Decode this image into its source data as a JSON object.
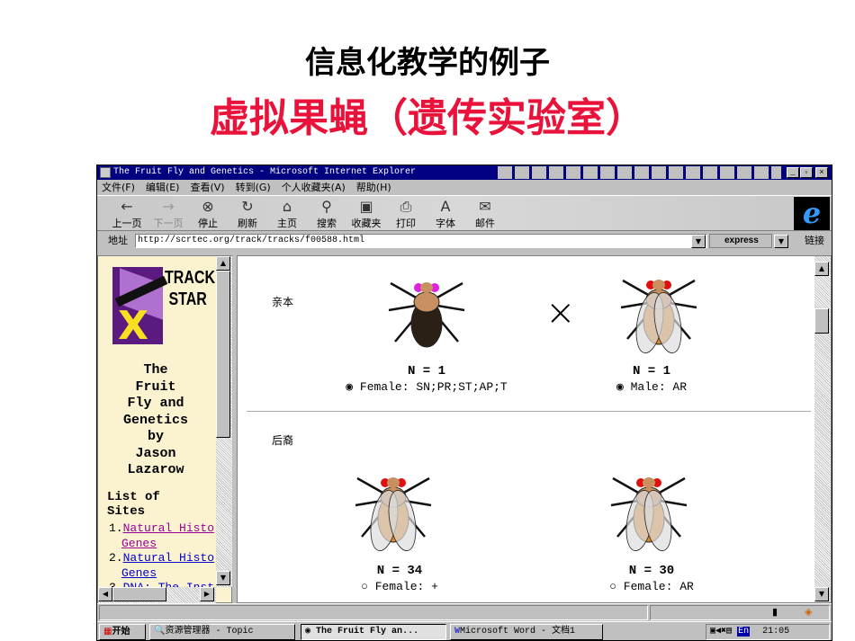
{
  "slide": {
    "title": "信息化教学的例子",
    "subtitle": "虚拟果蝇（遗传实验室）"
  },
  "window": {
    "title": "The Fruit Fly and Genetics - Microsoft Internet Explorer"
  },
  "menu": [
    "文件(F)",
    "编辑(E)",
    "查看(V)",
    "转到(G)",
    "个人收藏夹(A)",
    "帮助(H)"
  ],
  "toolbar": [
    {
      "label": "上一页",
      "icon": "←"
    },
    {
      "label": "下一页",
      "icon": "→"
    },
    {
      "label": "停止",
      "icon": "⊗"
    },
    {
      "label": "刷新",
      "icon": "↻"
    },
    {
      "label": "主页",
      "icon": "⌂"
    },
    {
      "label": "搜索",
      "icon": "⚲"
    },
    {
      "label": "收藏夹",
      "icon": "▣"
    },
    {
      "label": "打印",
      "icon": "⎙"
    },
    {
      "label": "字体",
      "icon": "A"
    },
    {
      "label": "邮件",
      "icon": "✉"
    }
  ],
  "address": {
    "label": "地址",
    "url": "http://scrtec.org/track/tracks/f00588.html",
    "links": "链接",
    "express": "express"
  },
  "sidebar": {
    "logo": "TRACK STAR",
    "lines": [
      "The",
      "Fruit",
      "Fly and",
      "Genetics",
      "by",
      "Jason",
      "Lazarow"
    ],
    "list_title": [
      "List of",
      "Sites"
    ],
    "items": [
      {
        "num": "1.",
        "l1": "Natural Histo",
        "l2": "Genes"
      },
      {
        "num": "2.",
        "l1": "Natural Histo",
        "l2": "Genes"
      },
      {
        "num": "3.",
        "l1": "DNA: The Inst"
      }
    ]
  },
  "main": {
    "parents_label": "亲本",
    "offspring_label": "后裔",
    "cross": "×",
    "parents": [
      {
        "n": "N = 1",
        "label": "Female: SN;PR;ST;AP;T",
        "checked": true
      },
      {
        "n": "N = 1",
        "label": "Male: AR",
        "checked": true
      }
    ],
    "offspring": [
      {
        "n": "N = 34",
        "label": "Female: +",
        "checked": false
      },
      {
        "n": "N = 30",
        "label": "Female: AR",
        "checked": false
      }
    ]
  },
  "taskbar": {
    "start": "开始",
    "tasks": [
      "资源管理器 - Topic",
      "The Fruit Fly an...",
      "Microsoft Word - 文档1"
    ],
    "lang": "En",
    "time": "21:05"
  }
}
